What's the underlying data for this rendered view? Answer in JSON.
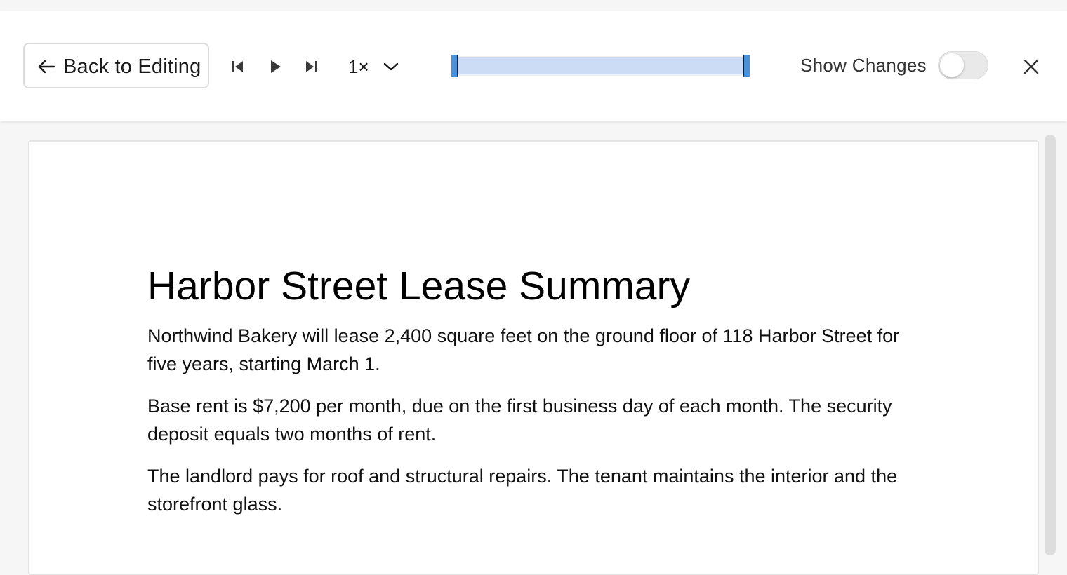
{
  "toolbar": {
    "back_label": "Back to Editing",
    "speed": "1×",
    "show_changes_label": "Show Changes",
    "show_changes_on": false,
    "timeline_selection": {
      "start_fraction": 0.0,
      "end_fraction": 1.0
    },
    "accent_color": "#4a90d9",
    "selection_color": "#cddcf5",
    "icons": {
      "back": "arrow-left-icon",
      "skip_start": "skip-to-start-icon",
      "play": "play-icon",
      "skip_end": "skip-to-end-icon",
      "speed_menu": "chevron-down-icon",
      "close": "close-icon"
    }
  },
  "document": {
    "title": "Harbor Street Lease Summary",
    "paragraphs": [
      "Northwind Bakery will lease 2,400 square feet on the ground floor of 118 Harbor Street for five years, starting March 1.",
      "Base rent is $7,200 per month, due on the first business day of each month. The security deposit equals two months of rent.",
      "The landlord pays for roof and structural repairs. The tenant maintains the interior and the storefront glass."
    ]
  }
}
